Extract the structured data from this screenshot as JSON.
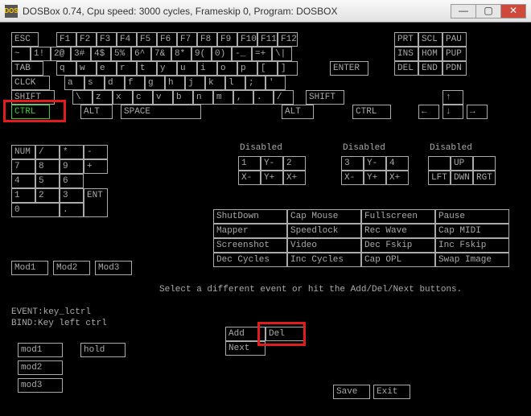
{
  "window": {
    "icon": "DOS",
    "title": "DOSBox 0.74, Cpu speed:    3000 cycles, Frameskip  0, Program:   DOSBOX",
    "min": "—",
    "max": "▢",
    "close": "✕"
  },
  "row1": [
    "ESC",
    "F1",
    "F2",
    "F3",
    "F4",
    "F5",
    "F6",
    "F7",
    "F8",
    "F9",
    "F10",
    "F11",
    "F12"
  ],
  "row1b": [
    "PRT",
    "SCL",
    "PAU"
  ],
  "row2": [
    "~",
    "1!",
    "2@",
    "3#",
    "4$",
    "5%",
    "6^",
    "7&",
    "8*",
    "9(",
    "0)",
    "-_",
    "=+",
    "\\|"
  ],
  "row2b": [
    "INS",
    "HOM",
    "PUP"
  ],
  "row3": [
    "TAB",
    "q",
    "w",
    "e",
    "r",
    "t",
    "y",
    "u",
    "i",
    "o",
    "p",
    "[",
    "]"
  ],
  "row3end": "ENTER",
  "row3b": [
    "DEL",
    "END",
    "PDN"
  ],
  "row4": [
    "CLCK",
    "a",
    "s",
    "d",
    "f",
    "g",
    "h",
    "j",
    "k",
    "l",
    ";",
    "'"
  ],
  "row5": [
    "SHIFT",
    "\\",
    "z",
    "x",
    "c",
    "v",
    "b",
    "n",
    "m",
    ",",
    ".",
    "/"
  ],
  "row5end": "SHIFT",
  "row6": {
    "ctrl": "CTRL",
    "alt": "ALT",
    "space": "SPACE",
    "alt2": "ALT",
    "ctrl2": "CTRL"
  },
  "arrow": {
    "up": "↑",
    "left": "←",
    "down": "↓",
    "right": "→"
  },
  "numpad": {
    "hdr": [
      "NUM",
      "/",
      "*",
      "-"
    ],
    "r2": [
      "7",
      "8",
      "9",
      "+"
    ],
    "r3": [
      "4",
      "5",
      "6"
    ],
    "r4": [
      "1",
      "2",
      "3",
      "ENT"
    ],
    "r5": [
      "0",
      ".",
      ""
    ]
  },
  "joy1": {
    "title": "Disabled",
    "cells": [
      "1",
      "Y-",
      "2",
      "X-",
      "Y+",
      "X+"
    ]
  },
  "joy2": {
    "title": "Disabled",
    "cells": [
      "3",
      "Y-",
      "4",
      "X-",
      "Y+",
      "X+"
    ]
  },
  "joy3": {
    "title": "Disabled",
    "cells": [
      "",
      "UP",
      "",
      "LFT",
      "DWN",
      "RGT"
    ]
  },
  "grid": [
    [
      "ShutDown",
      "Cap Mouse",
      "Fullscreen",
      "Pause"
    ],
    [
      "Mapper",
      "Speedlock",
      "Rec Wave",
      "Cap MIDI"
    ],
    [
      "Screenshot",
      "Video",
      "Dec Fskip",
      "Inc Fskip"
    ],
    [
      "Dec Cycles",
      "Inc Cycles",
      "Cap OPL",
      "Swap Image"
    ]
  ],
  "mods_top": [
    "Mod1",
    "Mod2",
    "Mod3"
  ],
  "msg": "Select a different event or hit the Add/Del/Next buttons.",
  "event": "EVENT:key_lctrl",
  "bind": "BIND:Key left ctrl",
  "ctl": {
    "add": "Add",
    "del": "Del",
    "next": "Next"
  },
  "mods_bot": [
    "mod1",
    "mod2",
    "mod3"
  ],
  "hold": "hold",
  "save": "Save",
  "exit": "Exit"
}
